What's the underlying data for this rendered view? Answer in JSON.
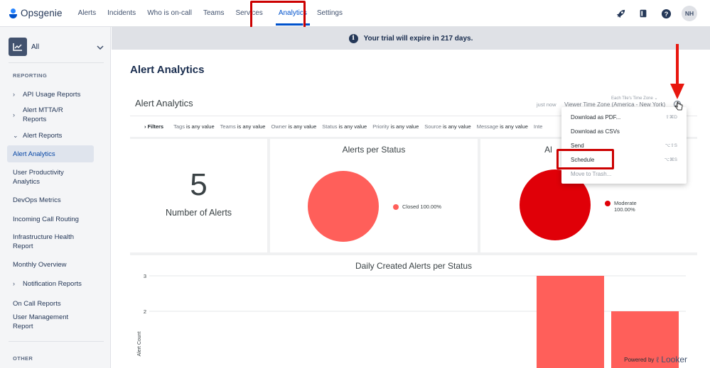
{
  "app": {
    "name": "Opsgenie"
  },
  "nav": {
    "items": [
      "Alerts",
      "Incidents",
      "Who is on-call",
      "Teams",
      "Services",
      "Analytics",
      "Settings"
    ],
    "active": "Analytics",
    "avatar": "NH"
  },
  "sidebar": {
    "space": "All",
    "reporting_label": "REPORTING",
    "items": [
      {
        "label": "API Usage Reports",
        "expandable": true
      },
      {
        "label": "Alert MTTA/R Reports",
        "expandable": true
      },
      {
        "label": "Alert Reports",
        "expandable": true,
        "expanded": true
      },
      {
        "label": "Alert Analytics",
        "active": true
      },
      {
        "label": "User Productivity Analytics"
      },
      {
        "label": "DevOps Metrics"
      },
      {
        "label": "Incoming Call Routing"
      },
      {
        "label": "Infrastructure Health Report"
      },
      {
        "label": "Monthly Overview"
      },
      {
        "label": "Notification Reports",
        "expandable": true
      },
      {
        "label": "On Call Reports"
      },
      {
        "label": "User Management Report"
      }
    ],
    "other_label": "OTHER"
  },
  "banner": {
    "text": "Your trial will expire in 217 days."
  },
  "page": {
    "title": "Alert Analytics"
  },
  "dashboard": {
    "title": "Alert Analytics",
    "updated": "just now",
    "timezone_label": "Each Tile's Time Zone",
    "timezone": "Viewer Time Zone (America - New York)",
    "filters_label": "Filters",
    "filters": [
      {
        "name": "Tags",
        "value": "is any value"
      },
      {
        "name": "Teams",
        "value": "is any value"
      },
      {
        "name": "Owner",
        "value": "is any value"
      },
      {
        "name": "Status",
        "value": "is any value"
      },
      {
        "name": "Priority",
        "value": "is any value"
      },
      {
        "name": "Source",
        "value": "is any value"
      },
      {
        "name": "Message",
        "value": "is any value"
      },
      {
        "name": "Inte",
        "value": ""
      }
    ]
  },
  "menu": {
    "items": [
      {
        "label": "Download as PDF...",
        "shortcut": "⇧⌘D"
      },
      {
        "label": "Download as CSVs",
        "shortcut": ""
      },
      {
        "label": "Send",
        "shortcut": "⌥⇧S"
      },
      {
        "label": "Schedule",
        "shortcut": "⌥⌘S"
      },
      {
        "label": "Move to Trash...",
        "shortcut": ""
      }
    ]
  },
  "tiles": {
    "count": {
      "value": "5",
      "label": "Number of Alerts"
    },
    "status": {
      "title": "Alerts per Status",
      "legend": "Closed 100.00%",
      "color": "#ff5f5a"
    },
    "priority": {
      "title_partial": "Al",
      "legend_name": "Moderate",
      "legend_pct": "100.00%",
      "color": "#e00008"
    },
    "daily": {
      "title": "Daily Created Alerts per Status",
      "ylabel": "Alert Count"
    }
  },
  "chart_data": {
    "type": "bar",
    "title": "Daily Created Alerts per Status",
    "ylabel": "Alert Count",
    "y_ticks": [
      2,
      3
    ],
    "values": [
      3,
      2
    ],
    "color": "#ff5f5a"
  },
  "footer": {
    "powered": "Powered by",
    "brand": "Looker"
  },
  "colors": {
    "accent": "#0052cc",
    "annotation": "#cc0000"
  }
}
